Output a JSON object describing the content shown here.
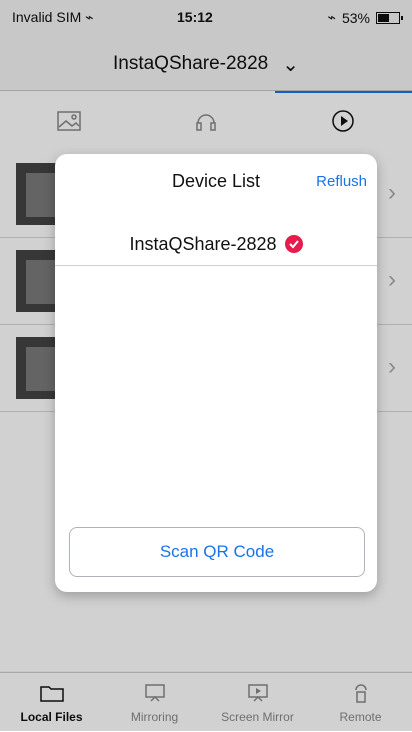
{
  "status": {
    "carrier": "Invalid SIM",
    "time": "15:12",
    "battery": "53%"
  },
  "title_bar": {
    "title": "InstaQShare-2828"
  },
  "tabs": [
    {
      "icon": "image-icon",
      "active": false
    },
    {
      "icon": "headphones-icon",
      "active": false
    },
    {
      "icon": "play-circle-icon",
      "active": true
    }
  ],
  "modal": {
    "title": "Device List",
    "refresh_label": "Reflush",
    "device_name": "InstaQShare-2828",
    "scan_button": "Scan QR Code",
    "accent": "#1a73e8",
    "check_color": "#e51d4d"
  },
  "bottom_tabs": [
    {
      "label": "Local Files",
      "active": true
    },
    {
      "label": "Mirroring",
      "active": false
    },
    {
      "label": "Screen Mirror",
      "active": false
    },
    {
      "label": "Remote",
      "active": false
    }
  ]
}
